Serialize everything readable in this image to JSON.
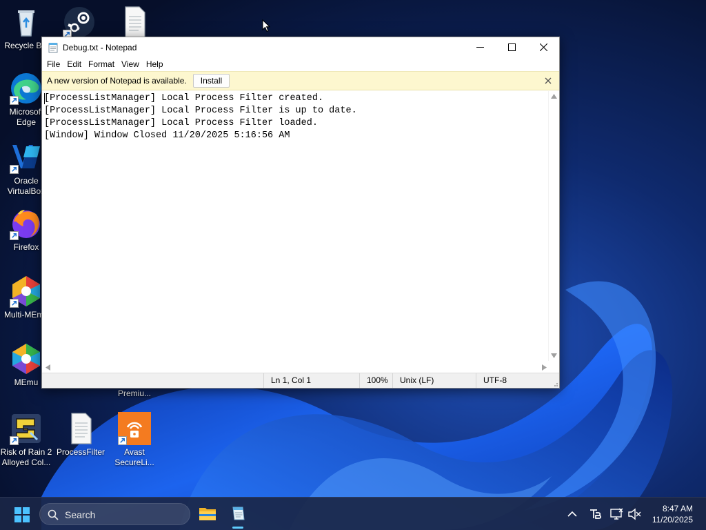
{
  "desktop": {
    "icons": [
      {
        "label": "Recycle Bin"
      },
      {
        "label": "Microsoft Edge"
      },
      {
        "label": "Oracle VirtualBox"
      },
      {
        "label": "Firefox"
      },
      {
        "label": "Multi-MEmu"
      },
      {
        "label": "MEmu"
      },
      {
        "label": "Risk of Rain 2 Alloyed Col..."
      },
      {
        "label": "ProcessFilter"
      },
      {
        "label": "Avast SecureLi..."
      },
      {
        "label": "Premiu..."
      }
    ]
  },
  "notepad": {
    "title": "Debug.txt - Notepad",
    "menu": [
      "File",
      "Edit",
      "Format",
      "View",
      "Help"
    ],
    "infobar": {
      "message": "A new version of Notepad is available.",
      "install_label": "Install"
    },
    "lines": [
      "[ProcessListManager] Local Process Filter created.",
      "[ProcessListManager] Local Process Filter is up to date.",
      "[ProcessListManager] Local Process Filter loaded.",
      "[Window] Window Closed 11/20/2025 5:16:56 AM"
    ],
    "status": {
      "position": "Ln 1, Col 1",
      "zoom": "100%",
      "line_endings": "Unix (LF)",
      "encoding": "UTF-8"
    }
  },
  "taskbar": {
    "search_placeholder": "Search",
    "time": "8:47 AM",
    "date": "11/20/2025"
  },
  "colors": {
    "accent": "#60cdff",
    "infobar": "#fdf7cf",
    "taskbar": "#1a2646"
  }
}
